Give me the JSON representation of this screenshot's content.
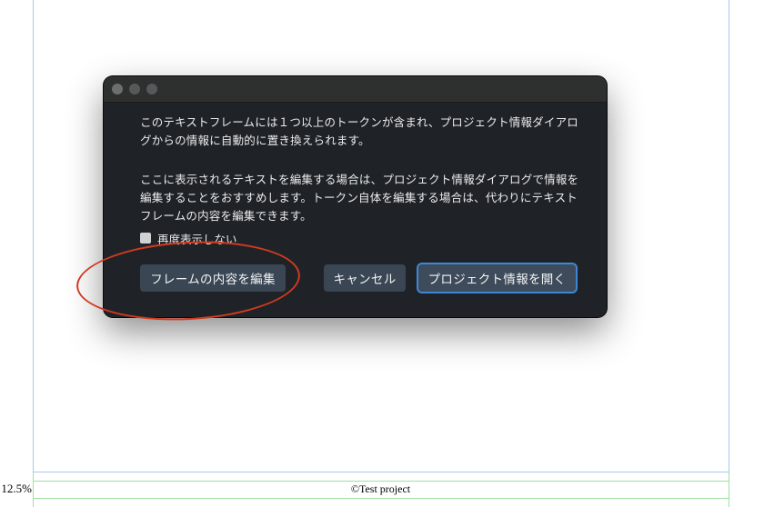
{
  "dialog": {
    "message_1": "このテキストフレームには１つ以上のトークンが含まれ、プロジェクト情報ダイアログからの情報に自動的に置き換えられます。",
    "message_2": "ここに表示されるテキストを編集する場合は、プロジェクト情報ダイアログで情報を編集することをおすすめします。トークン自体を編集する場合は、代わりにテキストフレームの内容を編集できます。",
    "checkbox_label": "再度表示しない",
    "checkbox_checked": false,
    "buttons": {
      "edit_frame": "フレームの内容を編集",
      "cancel": "キャンセル",
      "open_project_info": "プロジェクト情報を開く"
    }
  },
  "page": {
    "zoom_label": "12.5%",
    "footer_text": "©Test project"
  },
  "colors": {
    "dialog_bg": "#1f2327",
    "button_bg": "#3a4653",
    "focus_ring": "#3d87d6",
    "annotation": "#d03a20",
    "guide_blue": "#a9c8f2",
    "guide_green": "#9fe09f"
  }
}
